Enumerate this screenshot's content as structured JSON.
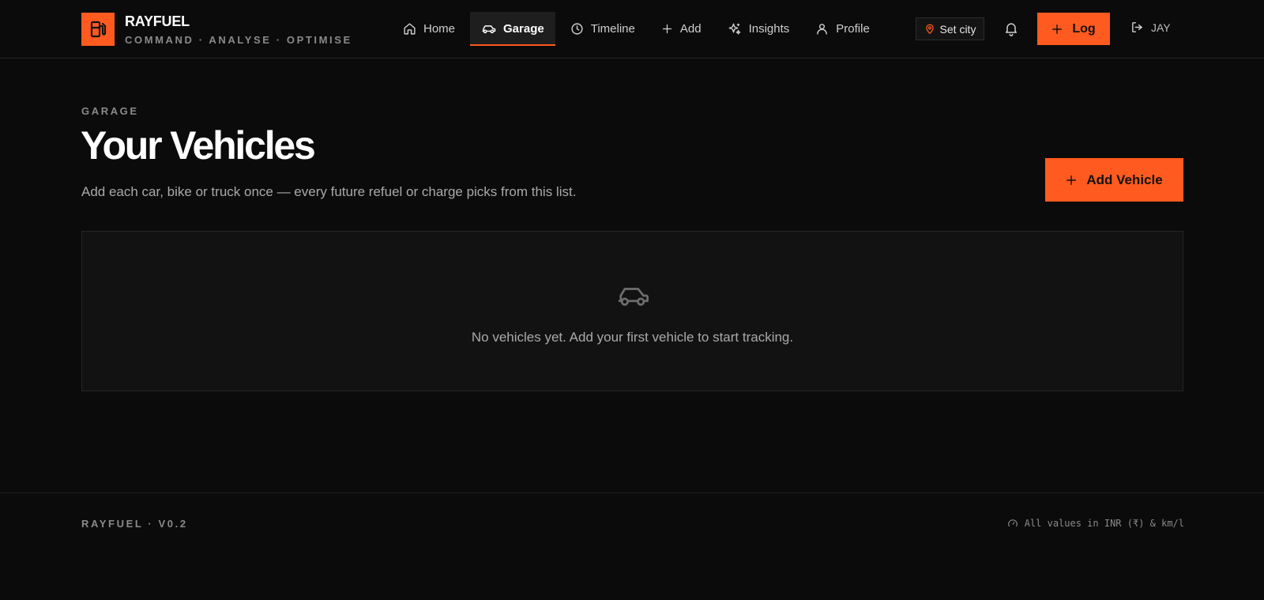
{
  "brand": {
    "name": "RAYFUEL",
    "tagline": "COMMAND · ANALYSE · OPTIMISE",
    "accent_color": "#ff5a1f",
    "logo_icon": "fuel-pump-icon"
  },
  "nav": {
    "items": [
      {
        "label": "Home",
        "icon": "home-icon",
        "active": false
      },
      {
        "label": "Garage",
        "icon": "car-icon",
        "active": true
      },
      {
        "label": "Timeline",
        "icon": "clock-icon",
        "active": false
      },
      {
        "label": "Add",
        "icon": "plus-icon",
        "active": false
      },
      {
        "label": "Insights",
        "icon": "sparkles-icon",
        "active": false
      },
      {
        "label": "Profile",
        "icon": "user-icon",
        "active": false
      }
    ]
  },
  "header_actions": {
    "city_label": "Set city",
    "city_icon": "map-pin-icon",
    "notification_icon": "bell-icon",
    "log_label": "Log",
    "user_label": "JAY",
    "user_icon": "logout-icon"
  },
  "page": {
    "eyebrow": "GARAGE",
    "title": "Your Vehicles",
    "subtitle": "Add each car, bike or truck once — every future refuel or charge picks from this list.",
    "add_vehicle_label": "Add Vehicle"
  },
  "empty_state": {
    "icon": "car-icon",
    "message": "No vehicles yet. Add your first vehicle to start tracking."
  },
  "footer": {
    "version": "RAYFUEL · V0.2",
    "units_note": "All values in INR (₹) & km/l",
    "units_icon": "gauge-icon"
  }
}
